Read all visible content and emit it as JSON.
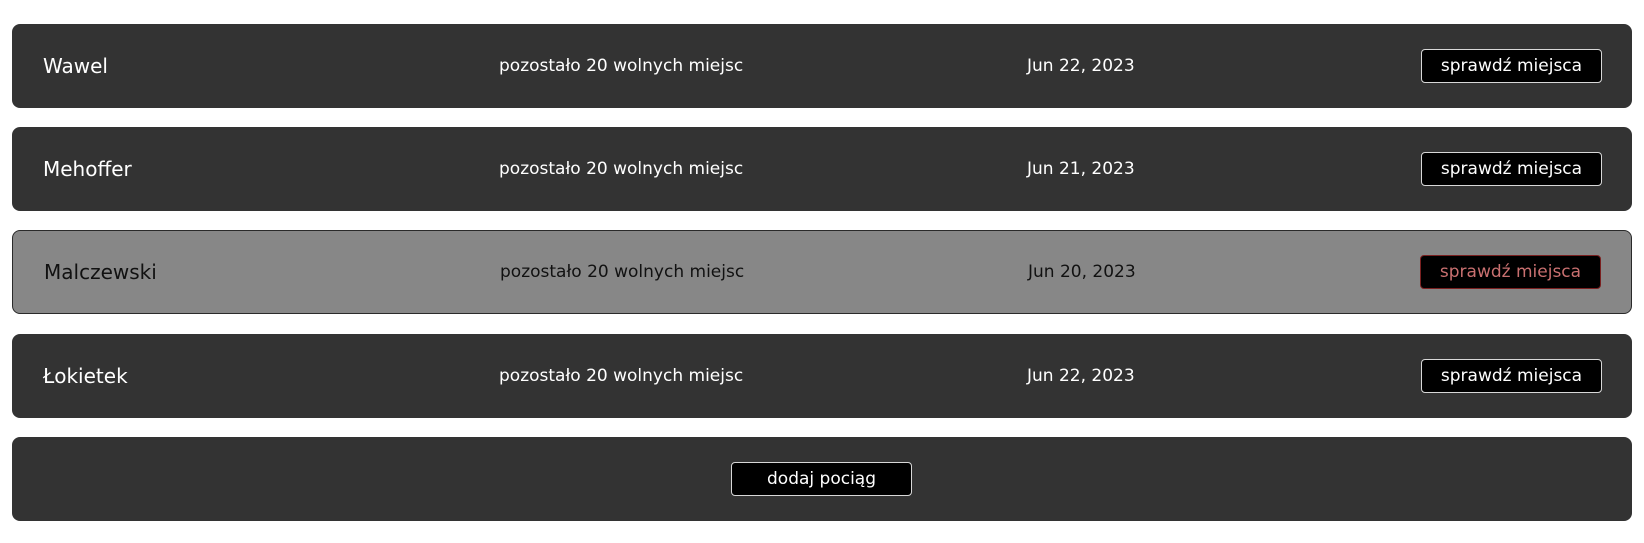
{
  "trains": [
    {
      "name": "Wawel",
      "seats": "pozostało 20 wolnych miejsc",
      "date": "Jun 22, 2023",
      "button": "sprawdź miejsca"
    },
    {
      "name": "Mehoffer",
      "seats": "pozostało 20 wolnych miejsc",
      "date": "Jun 21, 2023",
      "button": "sprawdź miejsca"
    },
    {
      "name": "Malczewski",
      "seats": "pozostało 20 wolnych miejsc",
      "date": "Jun 20, 2023",
      "button": "sprawdź miejsca"
    },
    {
      "name": "Łokietek",
      "seats": "pozostało 20 wolnych miejsc",
      "date": "Jun 22, 2023",
      "button": "sprawdź miejsca"
    }
  ],
  "add_train": {
    "label": "dodaj pociąg"
  },
  "colors": {
    "row_background": "#333333",
    "highlight_background": "#878787",
    "button_background": "#000000",
    "highlight_button_text": "#c97070"
  }
}
